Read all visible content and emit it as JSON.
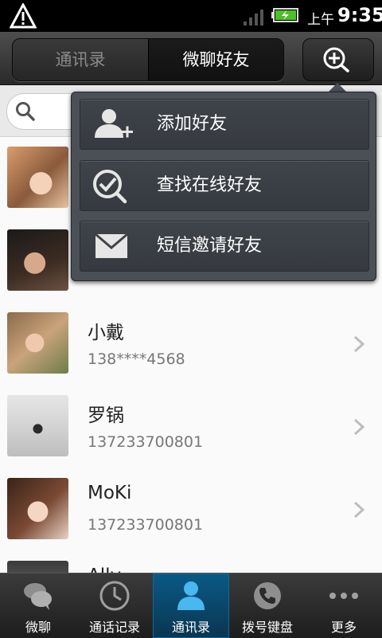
{
  "status_bar": {
    "warning_icon": "warning-triangle-icon",
    "signal_icon": "signal-bars-icon",
    "battery_icon": "battery-charging-icon",
    "ampm": "上午",
    "time": "9:35"
  },
  "top_tabs": [
    {
      "label": "通讯录",
      "active": false
    },
    {
      "label": "微聊好友",
      "active": true
    }
  ],
  "add_button_icon": "add-search-icon",
  "search": {
    "icon": "search-icon",
    "placeholder": ""
  },
  "popup_menu": {
    "items": [
      {
        "label": "添加好友",
        "icon": "add-person-icon"
      },
      {
        "label": "查找在线好友",
        "icon": "find-check-icon"
      },
      {
        "label": "短信邀请好友",
        "icon": "envelope-icon"
      }
    ]
  },
  "contacts": [
    {
      "name": "",
      "phone": ""
    },
    {
      "name": "",
      "phone": ""
    },
    {
      "name": "小戴",
      "phone": "138****4568"
    },
    {
      "name": "罗锅",
      "phone": "137233700801"
    },
    {
      "name": "MoKi",
      "phone": "137233700801"
    },
    {
      "name": "Ally",
      "phone": ""
    }
  ],
  "bottom_nav": [
    {
      "label": "微聊",
      "icon": "chat-bubbles-icon",
      "active": false
    },
    {
      "label": "通话记录",
      "icon": "clock-icon",
      "active": false
    },
    {
      "label": "通讯录",
      "icon": "contact-person-icon",
      "active": true
    },
    {
      "label": "拨号键盘",
      "icon": "phone-handset-icon",
      "active": false
    },
    {
      "label": "更多",
      "icon": "more-dots-icon",
      "active": false
    }
  ]
}
